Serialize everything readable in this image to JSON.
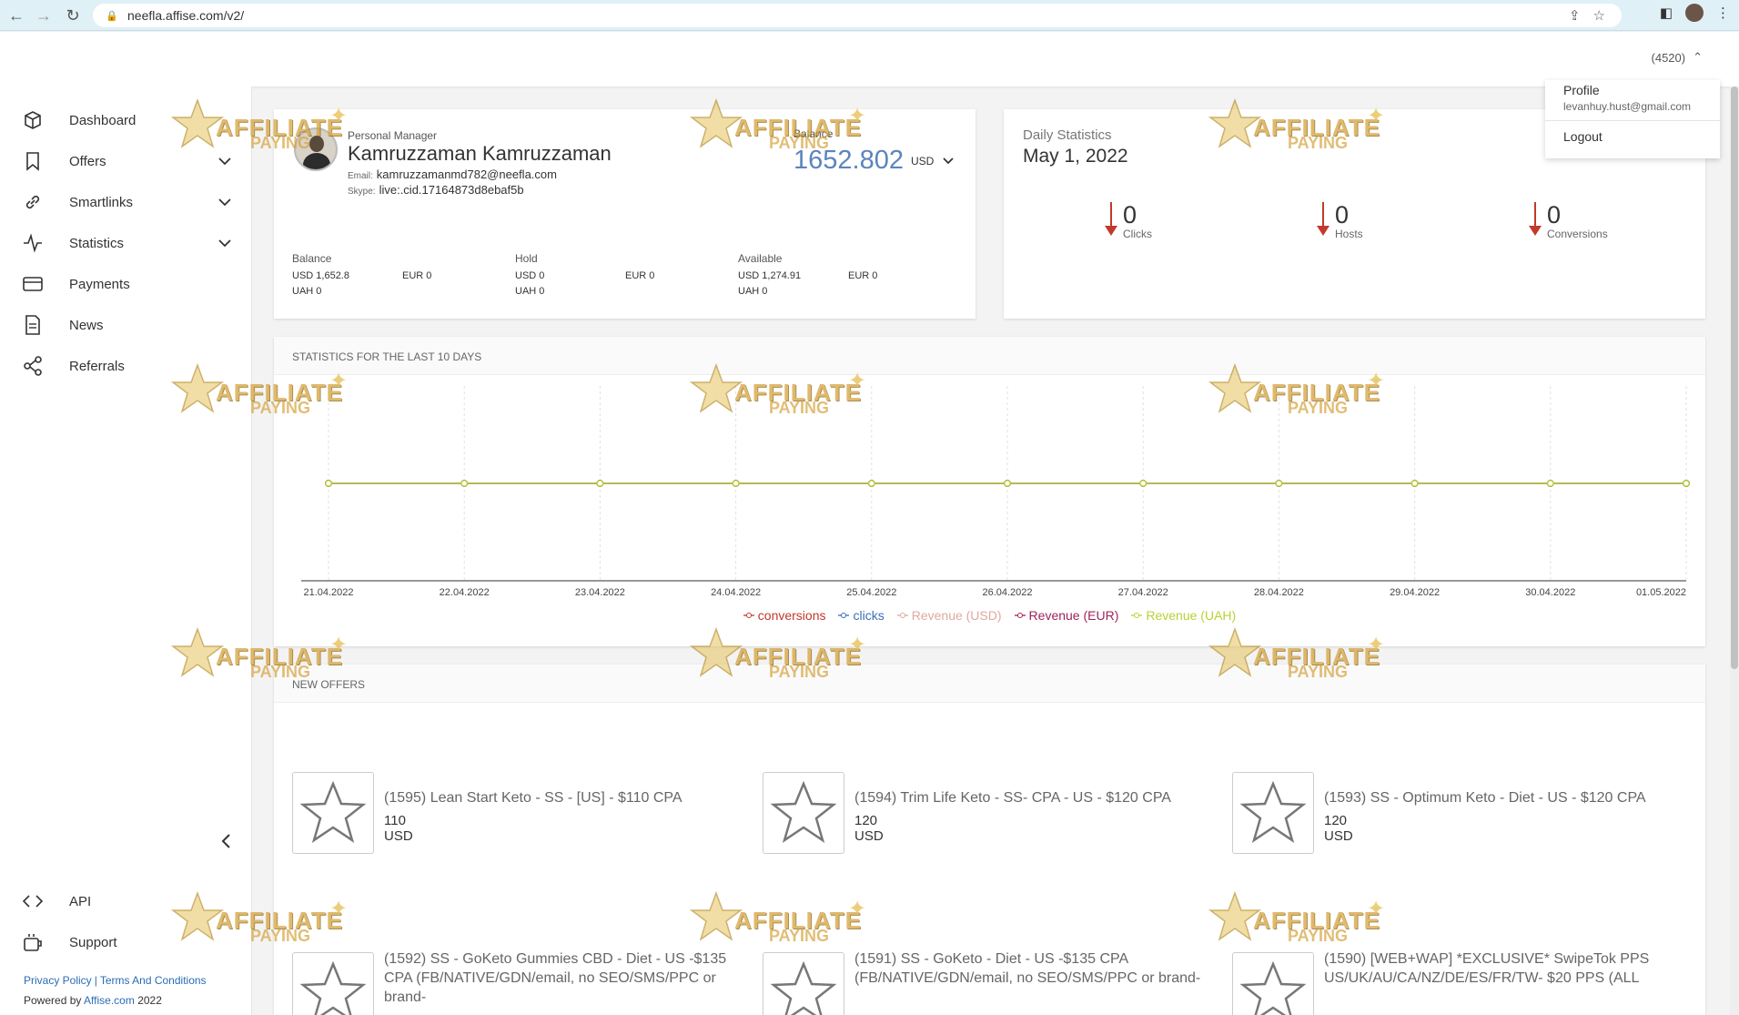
{
  "browser": {
    "url": "neefla.affise.com/v2/"
  },
  "header": {
    "user_id": "(4520)"
  },
  "dropdown": {
    "profile": "Profile",
    "email": "levanhuy.hust@gmail.com",
    "logout": "Logout"
  },
  "sidebar": {
    "items": [
      {
        "label": "Dashboard",
        "icon": "cube-icon"
      },
      {
        "label": "Offers",
        "icon": "bookmark-icon"
      },
      {
        "label": "Smartlinks",
        "icon": "link-icon"
      },
      {
        "label": "Statistics",
        "icon": "activity-icon"
      },
      {
        "label": "Payments",
        "icon": "card-icon"
      },
      {
        "label": "News",
        "icon": "document-icon"
      },
      {
        "label": "Referrals",
        "icon": "share-icon"
      }
    ],
    "api": "API",
    "support": "Support",
    "privacy": "Privacy Policy",
    "terms": "Terms And Conditions",
    "powered_prefix": "Powered by",
    "powered_link": "Affise.com",
    "year": "2022"
  },
  "manager": {
    "label": "Personal Manager",
    "name": "Kamruzzaman Kamruzzaman",
    "email_key": "Email:",
    "email": "kamruzzamanmd782@neefla.com",
    "skype_key": "Skype:",
    "skype": "live:.cid.17164873d8ebaf5b",
    "balance_label": "Balance",
    "balance_value": "1652.802",
    "balance_currency": "USD"
  },
  "finance": {
    "balance": {
      "title": "Balance",
      "usd": "USD 1,652.8",
      "eur": "EUR 0",
      "uah": "UAH 0"
    },
    "hold": {
      "title": "Hold",
      "usd": "USD 0",
      "eur": "EUR 0",
      "uah": "UAH 0"
    },
    "available": {
      "title": "Available",
      "usd": "USD 1,274.91",
      "eur": "EUR 0",
      "uah": "UAH 0"
    }
  },
  "daily": {
    "title": "Daily Statistics",
    "date": "May 1, 2022",
    "stats": [
      {
        "value": "0",
        "label": "Clicks"
      },
      {
        "value": "0",
        "label": "Hosts"
      },
      {
        "value": "0",
        "label": "Conversions"
      }
    ]
  },
  "stats_title": "STATISTICS FOR THE LAST 10 DAYS",
  "chart_data": {
    "type": "line",
    "x": [
      "21.04.2022",
      "22.04.2022",
      "23.04.2022",
      "24.04.2022",
      "25.04.2022",
      "26.04.2022",
      "27.04.2022",
      "28.04.2022",
      "29.04.2022",
      "30.04.2022",
      "01.05.2022"
    ],
    "series": [
      {
        "name": "conversions",
        "color": "#c0392b",
        "values": [
          0,
          0,
          0,
          0,
          0,
          0,
          0,
          0,
          0,
          0,
          0
        ]
      },
      {
        "name": "clicks",
        "color": "#3b6fb6",
        "values": [
          0,
          0,
          0,
          0,
          0,
          0,
          0,
          0,
          0,
          0,
          0
        ]
      },
      {
        "name": "Revenue (USD)",
        "color": "#e0a9a0",
        "values": [
          0,
          0,
          0,
          0,
          0,
          0,
          0,
          0,
          0,
          0,
          0
        ]
      },
      {
        "name": "Revenue (EUR)",
        "color": "#a0245a",
        "values": [
          0,
          0,
          0,
          0,
          0,
          0,
          0,
          0,
          0,
          0,
          0
        ]
      },
      {
        "name": "Revenue (UAH)",
        "color": "#b5d334",
        "values": [
          0,
          0,
          0,
          0,
          0,
          0,
          0,
          0,
          0,
          0,
          0
        ]
      }
    ],
    "grid": true,
    "legend": "bottom"
  },
  "offers": {
    "title": "NEW OFFERS",
    "items": [
      {
        "title": "(1595) Lean Start Keto - SS - [US] - $110 CPA",
        "price": "110 USD"
      },
      {
        "title": "(1594) Trim Life Keto - SS- CPA - US - $120 CPA",
        "price": "120 USD"
      },
      {
        "title": "(1593) SS - Optimum Keto - Diet - US - $120 CPA",
        "price": "120 USD"
      },
      {
        "title": "(1592) SS - GoKeto Gummies CBD - Diet - US -$135 CPA (FB/NATIVE/GDN/email, no SEO/SMS/PPC or brand-",
        "price": ""
      },
      {
        "title": "(1591) SS - GoKeto - Diet - US -$135 CPA (FB/NATIVE/GDN/email, no SEO/SMS/PPC or brand-",
        "price": ""
      },
      {
        "title": "(1590) [WEB+WAP] *EXCLUSIVE* SwipeTok PPS US/UK/AU/CA/NZ/DE/ES/FR/TW- $20 PPS (ALL",
        "price": ""
      }
    ]
  },
  "watermark": {
    "line1": "AFFILIATE",
    "line2": "PAYING"
  }
}
